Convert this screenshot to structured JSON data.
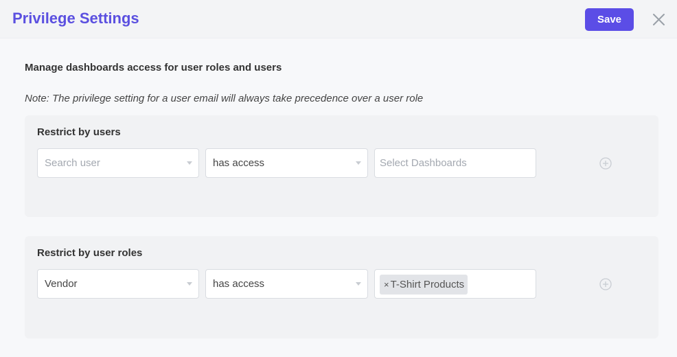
{
  "header": {
    "title": "Privilege Settings",
    "save_label": "Save",
    "accent": "#5b4de6"
  },
  "intro": "Manage dashboards access for user roles and users",
  "note": "Note: The privilege setting for a user email will always take precedence over a user role",
  "restrict_users": {
    "title": "Restrict by users",
    "user_select": {
      "placeholder": "Search user"
    },
    "access_select": {
      "value": "has access"
    },
    "dashboards": {
      "placeholder": "Select Dashboards"
    }
  },
  "restrict_roles": {
    "title": "Restrict by user roles",
    "role_select": {
      "value": "Vendor"
    },
    "access_select": {
      "value": "has access"
    },
    "dashboards": {
      "tags": [
        {
          "remove": "×",
          "label": "T-Shirt Products"
        }
      ]
    }
  }
}
